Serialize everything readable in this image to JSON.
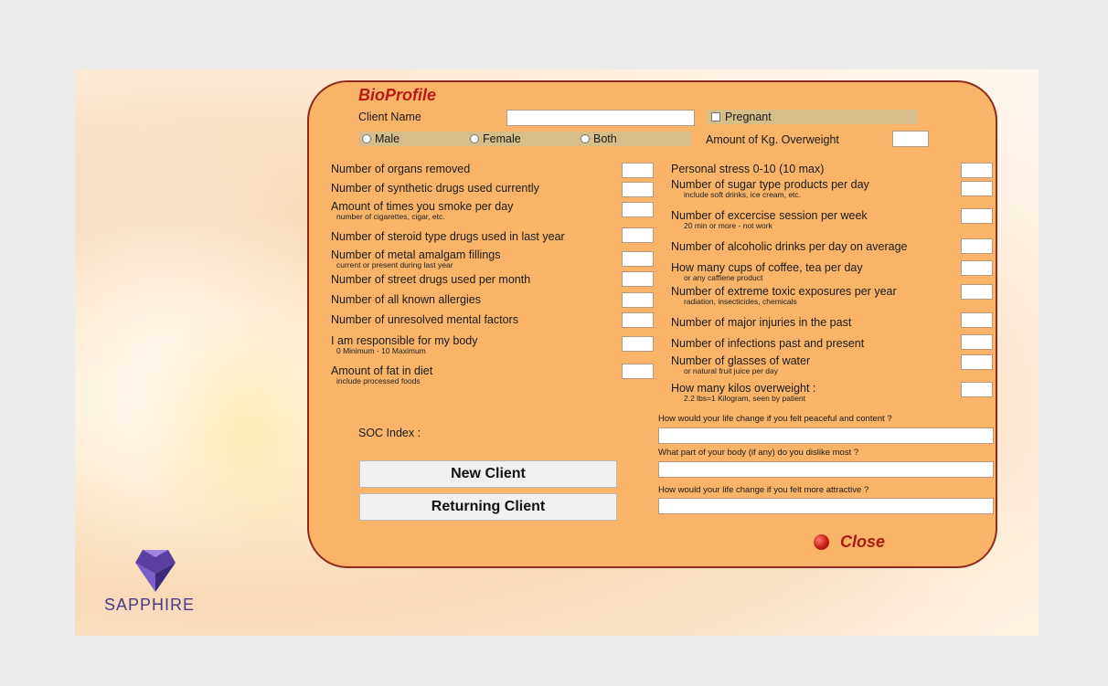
{
  "app": {
    "title": "BioProfile",
    "brand": "SAPPHIRE"
  },
  "colors": {
    "panel": "#fab469",
    "panel_border": "#8d2c1c",
    "title": "#b41a1a",
    "band": "#d6bd8a"
  },
  "header": {
    "client_name_label": "Client Name",
    "client_name_value": "",
    "pregnant_label": "Pregnant",
    "gender": {
      "male": "Male",
      "female": "Female",
      "both": "Both"
    },
    "overweight_label": "Amount of Kg. Overweight",
    "overweight_value": ""
  },
  "left_fields": [
    {
      "label": "Number of organs removed",
      "sub": "",
      "value": ""
    },
    {
      "label": "Number of synthetic drugs used currently",
      "sub": "",
      "value": ""
    },
    {
      "label": "Amount of times you smoke per day",
      "sub": "number of cigarettes, cigar, etc.",
      "value": ""
    },
    {
      "label": "Number of steroid type drugs used in last year",
      "sub": "",
      "value": ""
    },
    {
      "label": "Number of metal amalgam fillings",
      "sub": "current or present during last year",
      "value": ""
    },
    {
      "label": "Number of street drugs used per month",
      "sub": "",
      "value": ""
    },
    {
      "label": "Number of all known allergies",
      "sub": "",
      "value": ""
    },
    {
      "label": "Number of unresolved mental factors",
      "sub": "",
      "value": ""
    },
    {
      "label": "I am responsible for my body",
      "sub": "0 Minimum - 10 Maximum",
      "value": ""
    },
    {
      "label": "Amount of fat in diet",
      "sub": "include processed foods",
      "value": ""
    }
  ],
  "right_fields": [
    {
      "label": "Personal stress 0-10 (10 max)",
      "sub": "",
      "value": ""
    },
    {
      "label": "Number of sugar type products per day",
      "sub": "include soft drinks, ice cream, etc.",
      "value": ""
    },
    {
      "label": "Number of excercise session per week",
      "sub": "20 min or more - not work",
      "value": ""
    },
    {
      "label": "Number of alcoholic drinks per day on average",
      "sub": "",
      "value": ""
    },
    {
      "label": "How many cups of coffee, tea per day",
      "sub": "or any caffiene product",
      "value": ""
    },
    {
      "label": "Number of extreme toxic exposures per year",
      "sub": "radiation, insecticides, chemicals",
      "value": ""
    },
    {
      "label": "Number of major injuries in the past",
      "sub": "",
      "value": ""
    },
    {
      "label": "Number of infections past and present",
      "sub": "",
      "value": ""
    },
    {
      "label": "Number of glasses of water",
      "sub": "or natural fruit juice per day",
      "value": ""
    },
    {
      "label": "How many kilos overweight :",
      "sub": "2.2 lbs=1 Kilogram, seen by patient",
      "value": ""
    }
  ],
  "soc": {
    "label": "SOC Index :"
  },
  "questions": [
    {
      "label": "How would your life change if you felt peaceful and content ?",
      "value": ""
    },
    {
      "label": "What part of your body (if any) do you dislike most ?",
      "value": ""
    },
    {
      "label": "How would your life change if you felt more attractive ?",
      "value": ""
    }
  ],
  "buttons": {
    "new_client": "New Client",
    "returning_client": "Returning Client",
    "close": "Close"
  }
}
